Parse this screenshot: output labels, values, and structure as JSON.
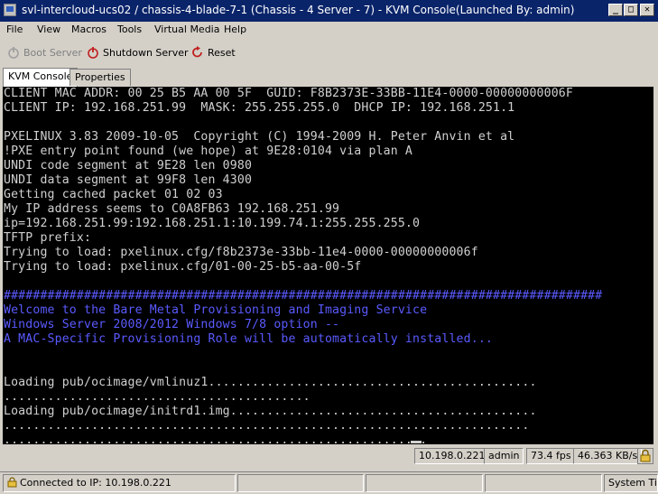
{
  "window": {
    "title": "svl-intercloud-ucs02 / chassis-4-blade-7-1 (Chassis - 4 Server - 7) - KVM Console(Launched By: admin)",
    "minimize": "_",
    "maximize": "□",
    "close": "✕"
  },
  "menu": [
    "File",
    "View",
    "Macros",
    "Tools",
    "Virtual Media",
    "Help"
  ],
  "toolbar": {
    "boot_server": "Boot Server",
    "shutdown_server": "Shutdown Server",
    "reset": "Reset"
  },
  "tabs": [
    "KVM Console",
    "Properties"
  ],
  "console": {
    "lines": [
      {
        "text": "CLIENT MAC ADDR: 00 25 B5 AA 00 5F  GUID: F8B2373E-33BB-11E4-0000-00000000006F",
        "style": "normal"
      },
      {
        "text": "CLIENT IP: 192.168.251.99  MASK: 255.255.255.0  DHCP IP: 192.168.251.1",
        "style": "normal"
      },
      {
        "text": "",
        "style": "normal"
      },
      {
        "text": "PXELINUX 3.83 2009-10-05  Copyright (C) 1994-2009 H. Peter Anvin et al",
        "style": "normal"
      },
      {
        "text": "!PXE entry point found (we hope) at 9E28:0104 via plan A",
        "style": "normal"
      },
      {
        "text": "UNDI code segment at 9E28 len 0980",
        "style": "normal"
      },
      {
        "text": "UNDI data segment at 99F8 len 4300",
        "style": "normal"
      },
      {
        "text": "Getting cached packet 01 02 03",
        "style": "normal"
      },
      {
        "text": "My IP address seems to C0A8FB63 192.168.251.99",
        "style": "normal"
      },
      {
        "text": "ip=192.168.251.99:192.168.251.1:10.199.74.1:255.255.255.0",
        "style": "normal"
      },
      {
        "text": "TFTP prefix:",
        "style": "normal"
      },
      {
        "text": "Trying to load: pxelinux.cfg/f8b2373e-33bb-11e4-0000-00000000006f",
        "style": "normal"
      },
      {
        "text": "Trying to load: pxelinux.cfg/01-00-25-b5-aa-00-5f",
        "style": "normal"
      },
      {
        "text": "",
        "style": "normal"
      },
      {
        "text": "##################################################################################",
        "style": "blue"
      },
      {
        "text": "Welcome to the Bare Metal Provisioning and Imaging Service",
        "style": "blue"
      },
      {
        "text": "Windows Server 2008/2012 Windows 7/8 option --",
        "style": "blue"
      },
      {
        "text": "A MAC-Specific Provisioning Role will be automatically installed...",
        "style": "blue"
      },
      {
        "text": "",
        "style": "normal"
      },
      {
        "text": "",
        "style": "normal"
      },
      {
        "text": "Loading pub/ocimage/vmlinuz1.............................................",
        "style": "normal"
      },
      {
        "text": "..........................................",
        "style": "normal"
      },
      {
        "text": "Loading pub/ocimage/initrd1.img..........................................",
        "style": "normal"
      },
      {
        "text": "........................................................................",
        "style": "normal"
      },
      {
        "text": "..........................................................",
        "style": "normal"
      }
    ]
  },
  "status": {
    "ip": "10.198.0.221",
    "user": "admin",
    "fps": "73.4 fps",
    "rate": "46.363 KB/s"
  },
  "bottom": {
    "connected": "Connected to IP: 10.198.0.221",
    "system_time": "System Time:"
  }
}
